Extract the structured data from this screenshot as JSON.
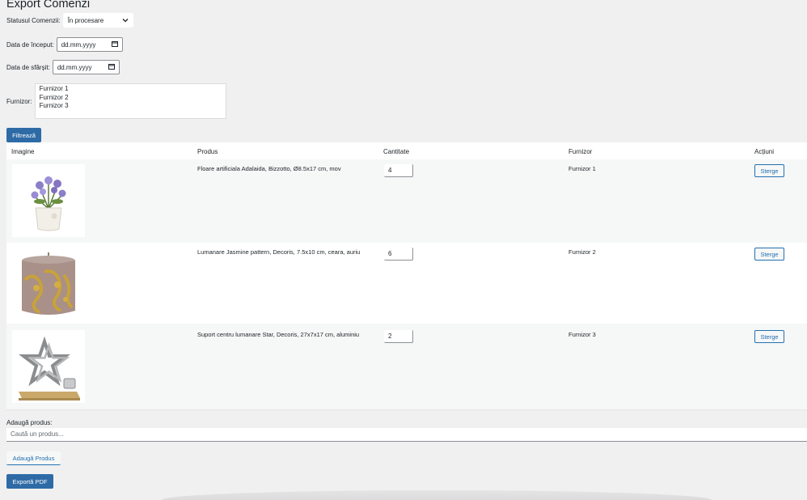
{
  "page": {
    "title": "Export Comenzi"
  },
  "filters": {
    "status_label": "Statusul Comenzii:",
    "status_value": "În procesare",
    "start_label": "Data de început:",
    "start_value": "dd.mm.yyyy",
    "end_label": "Data de sfârșit:",
    "end_value": "dd.mm.yyyy",
    "supplier_label": "Furnizor:",
    "supplier_options": [
      "Furnizor 1",
      "Furnizor 2",
      "Furnizor 3"
    ],
    "filter_button": "Filtrează"
  },
  "table": {
    "headers": {
      "image": "Imagine",
      "product": "Produs",
      "quantity": "Cantitate",
      "supplier": "Furnizor",
      "actions": "Acțiuni"
    },
    "rows": [
      {
        "image_icon": "flower-pot-image",
        "product": "Floare artificiala Adalaida, Bizzotto, Ø8.5x17 cm, mov",
        "quantity": "4",
        "supplier": "Furnizor 1",
        "delete_label": "Sterge"
      },
      {
        "image_icon": "candle-image",
        "product": "Lumanare Jasmine pattern, Decoris, 7.5x10 cm, ceara, auriu",
        "quantity": "6",
        "supplier": "Furnizor 2",
        "delete_label": "Sterge"
      },
      {
        "image_icon": "star-candle-holder-image",
        "product": "Suport centru lumanare Star, Decoris, 27x7x17 cm, aluminiu",
        "quantity": "2",
        "supplier": "Furnizor 3",
        "delete_label": "Sterge"
      }
    ]
  },
  "add_product": {
    "label": "Adaugă produs:",
    "placeholder": "Caută un produs...",
    "button": "Adaugă Produs"
  },
  "export_button": "Exportă PDF",
  "colors": {
    "primary": "#2e6ba6",
    "link": "#2271b1",
    "background": "#f0f0f1"
  }
}
